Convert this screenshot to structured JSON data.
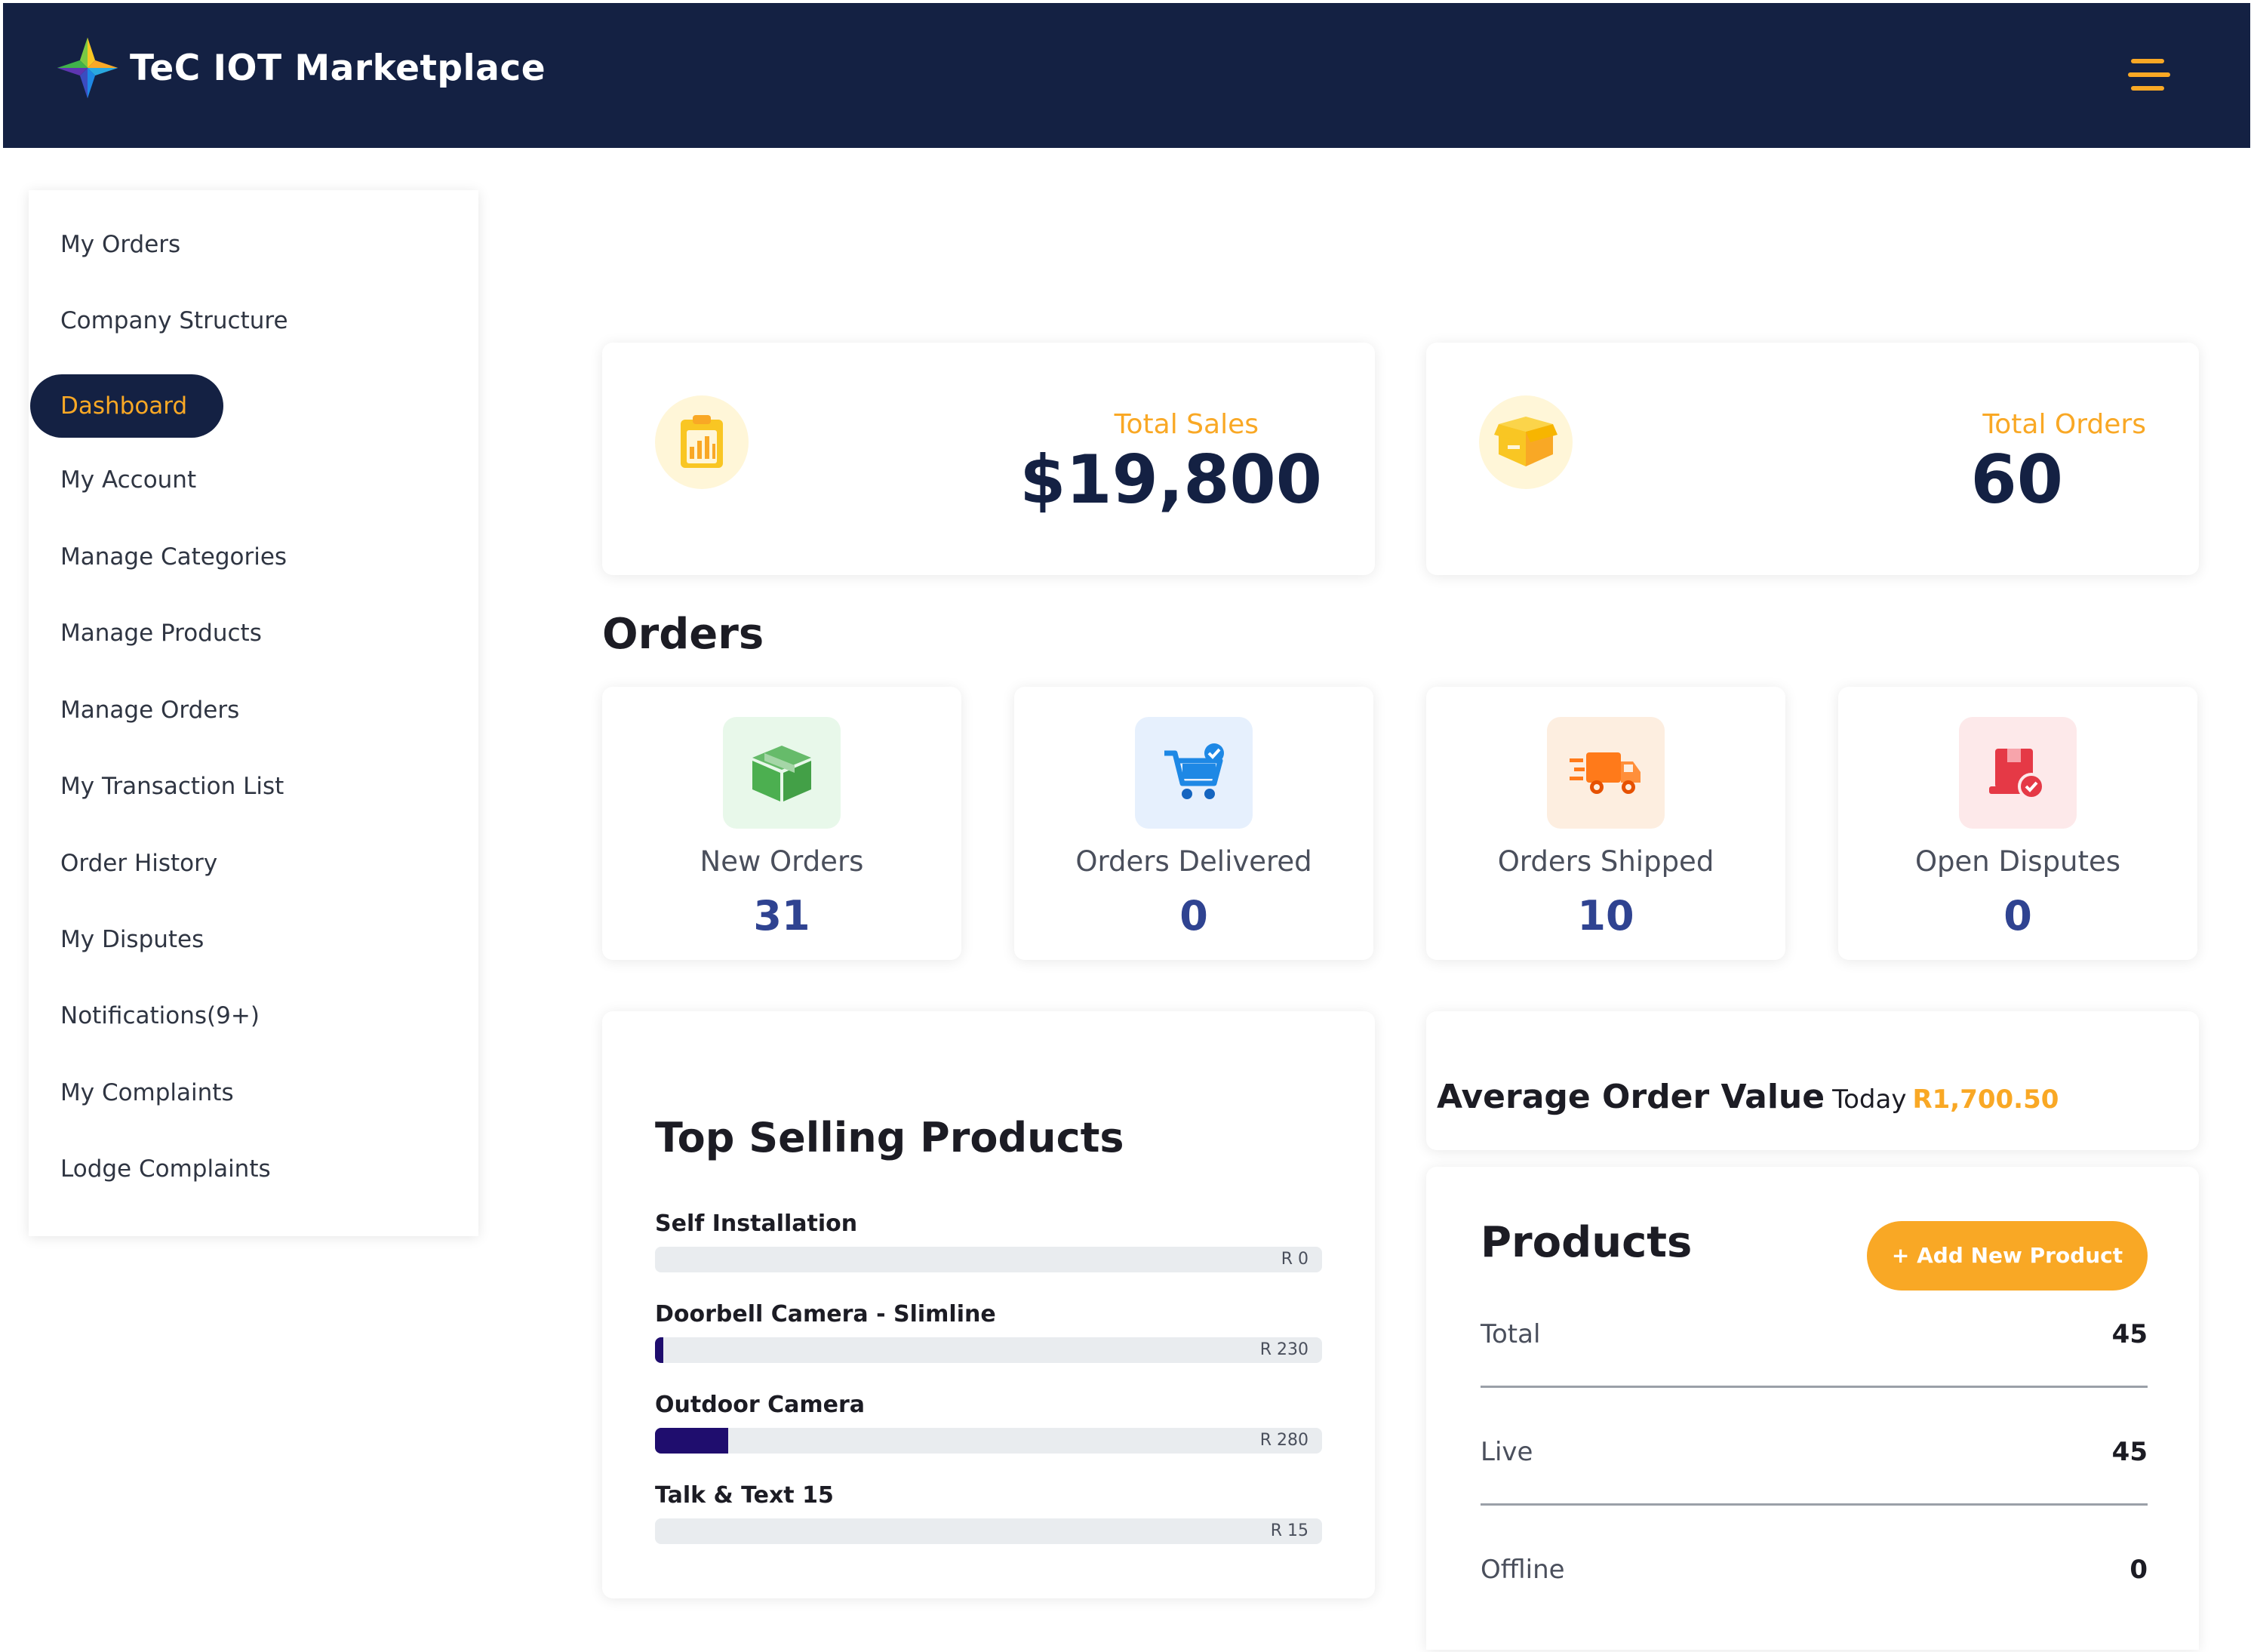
{
  "header": {
    "title": "TeC IOT Marketplace",
    "logo_icon": "four-point-star-logo",
    "menu_icon": "hamburger-menu-icon",
    "colors": {
      "navy": "#142143",
      "accent": "#f9a825"
    }
  },
  "sidebar": {
    "items": [
      {
        "label": "My Orders"
      },
      {
        "label": "Company Structure"
      },
      {
        "label": "Dashboard",
        "active": true
      },
      {
        "label": "My Account"
      },
      {
        "label": "Manage Categories"
      },
      {
        "label": "Manage Products"
      },
      {
        "label": "Manage Orders"
      },
      {
        "label": "My Transaction List"
      },
      {
        "label": "Order History"
      },
      {
        "label": "My Disputes"
      },
      {
        "label": "Notifications(9+)"
      },
      {
        "label": "My Complaints"
      },
      {
        "label": "Lodge Complaints"
      }
    ]
  },
  "summary": {
    "total_sales": {
      "label": "Total Sales",
      "value": "$19,800",
      "icon": "clipboard-chart-icon"
    },
    "total_orders": {
      "label": "Total Orders",
      "value": "60",
      "icon": "open-box-icon"
    }
  },
  "orders": {
    "title": "Orders",
    "cards": [
      {
        "label": "New Orders",
        "value": "31",
        "icon": "cube-box-icon",
        "bg": "#e8f8ea",
        "fg": "#4caf50"
      },
      {
        "label": "Orders Delivered",
        "value": "0",
        "icon": "shopping-cart-check-icon",
        "bg": "#e6f0fd",
        "fg": "#1e88e5"
      },
      {
        "label": "Orders Shipped",
        "value": "10",
        "icon": "delivery-truck-icon",
        "bg": "#fdeee0",
        "fg": "#ff7a1a"
      },
      {
        "label": "Open Disputes",
        "value": "0",
        "icon": "package-alert-icon",
        "bg": "#fde9ea",
        "fg": "#e53946"
      }
    ]
  },
  "top_selling": {
    "title": "Top Selling Products",
    "products": [
      {
        "name": "Self Installation",
        "amount": "R 0",
        "fraction": 0
      },
      {
        "name": "Doorbell Camera - Slimline",
        "amount": "R 230",
        "fraction": 0.012
      },
      {
        "name": "Outdoor Camera",
        "amount": "R 280",
        "fraction": 0.11
      },
      {
        "name": "Talk & Text 15",
        "amount": "R 15",
        "fraction": 0
      }
    ]
  },
  "average_order": {
    "label": "Average Order Value",
    "today_label": "Today",
    "value": "R1,700.50"
  },
  "products": {
    "title": "Products",
    "add_button": "+ Add New Product",
    "rows": [
      {
        "label": "Total",
        "value": "45"
      },
      {
        "label": "Live",
        "value": "45"
      },
      {
        "label": "Offline",
        "value": "0"
      }
    ]
  }
}
